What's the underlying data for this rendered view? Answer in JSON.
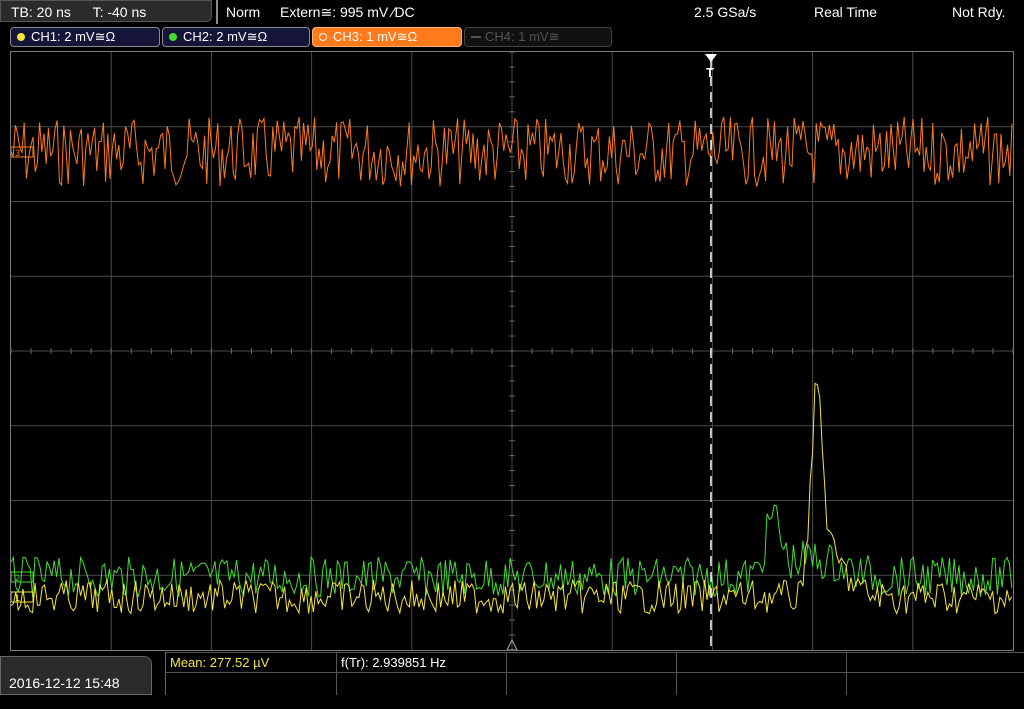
{
  "topbar": {
    "timebase": "TB: 20 ns",
    "trigger_time": "T: -40 ns",
    "mode": "Norm",
    "trigger_source": "Extern≅: 995 mV ∕DC",
    "sample_rate": "2.5 GSa/s",
    "acq_mode": "Real Time",
    "status": "Not Rdy."
  },
  "channels": [
    {
      "label": "CH1: 2 mV≅Ω",
      "color": "#f5e63c",
      "active": false
    },
    {
      "label": "CH2: 2 mV≅Ω",
      "color": "#44dd33",
      "active": false
    },
    {
      "label": "CH3: 1 mV≅Ω",
      "color": "#ff7a1a",
      "active": true
    },
    {
      "label": "CH4: 1 mV≅",
      "color": "#555555",
      "active": false
    }
  ],
  "markers": {
    "trigger_marker": "T",
    "ch3_marker": "3",
    "ch2_marker": "2",
    "ch1_marker": "1"
  },
  "measurements": {
    "mean": "Mean: 277.52 µV",
    "freq": "f(Tr): 2.939851 Hz"
  },
  "datetime": "2016-12-12 15:48",
  "colors": {
    "ch1": "#f5e63c",
    "ch2": "#44dd33",
    "ch3": "#ff7a1a",
    "grid": "#4a4a4a"
  }
}
